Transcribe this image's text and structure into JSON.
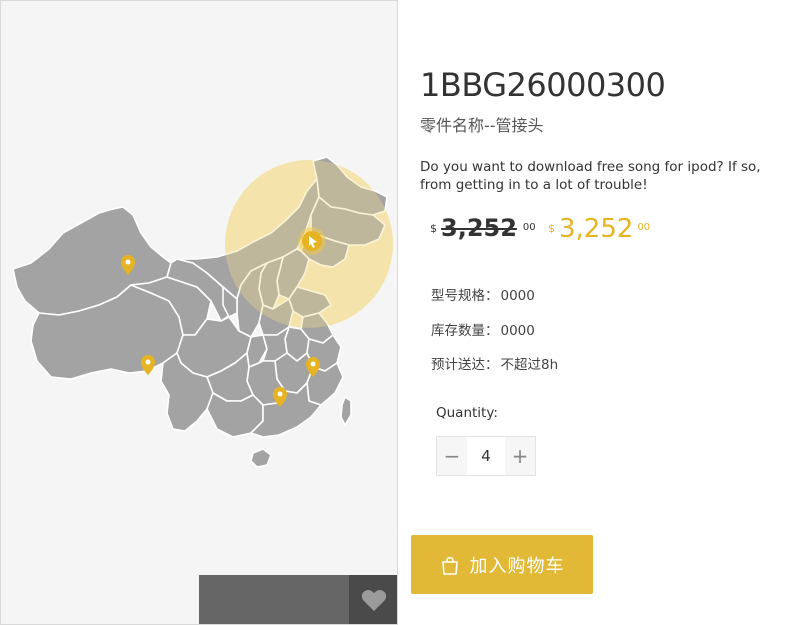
{
  "product": {
    "part_number": "1BBG26000300",
    "part_name": "零件名称--管接头",
    "description": "Do you want to download free song for ipod? If so, from getting in to a lot of trouble!"
  },
  "price": {
    "old": {
      "currency": "$",
      "main": "3,252",
      "cents": "00"
    },
    "new": {
      "currency": "$",
      "main": "3,252",
      "cents": "00"
    }
  },
  "specs": [
    {
      "label": "型号规格：",
      "value": "0000"
    },
    {
      "label": "库存数量：",
      "value": "0000"
    },
    {
      "label": "预计送达：",
      "value": "不超过8h"
    }
  ],
  "quantity": {
    "label": "Quantity:",
    "value": "4",
    "decrement": "−",
    "increment": "+"
  },
  "cart_button": {
    "label": "加入购物车"
  },
  "colors": {
    "accent": "#e2b936",
    "price_new": "#e6b422",
    "map_region": "#a3a3a3",
    "map_border": "#ffffff",
    "highlight_circle": "#f5e6b3"
  },
  "icons": {
    "favorite": "heart-icon",
    "cart": "shopping-bag-icon",
    "map_pin": "map-pin-icon",
    "cursor": "cursor-icon"
  }
}
